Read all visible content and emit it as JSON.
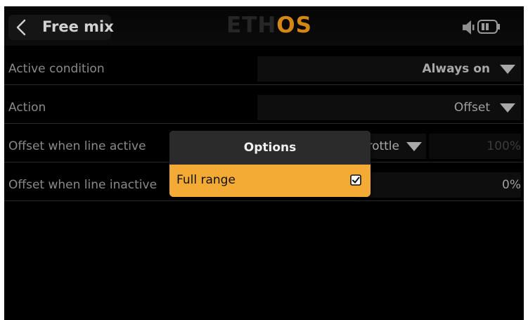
{
  "header": {
    "title": "Free mix",
    "brand_part1": "ETH",
    "brand_part2": "OS"
  },
  "rows": [
    {
      "label": "Active condition",
      "value": "Always on"
    },
    {
      "label": "Action",
      "value": "Offset"
    },
    {
      "label": "Offset when line active",
      "source_value": "Throttle",
      "value": "100%"
    },
    {
      "label": "Offset when line inactive",
      "value": "0%"
    }
  ],
  "popup": {
    "title": "Options",
    "option_label": "Full range",
    "option_checked": true
  },
  "icons": {
    "back": "chevron-left-icon",
    "speaker": "speaker-icon",
    "battery": "battery-icon",
    "dropdown": "triangle-down-icon",
    "checkbox": "checkbox-checked-icon"
  },
  "colors": {
    "background": "#000000",
    "accent": "#f4ab35",
    "brand_accent": "#d48714",
    "label_text": "#8a8a8a",
    "value_text": "#a0a0a0",
    "popup_header": "#2b2b2b"
  }
}
